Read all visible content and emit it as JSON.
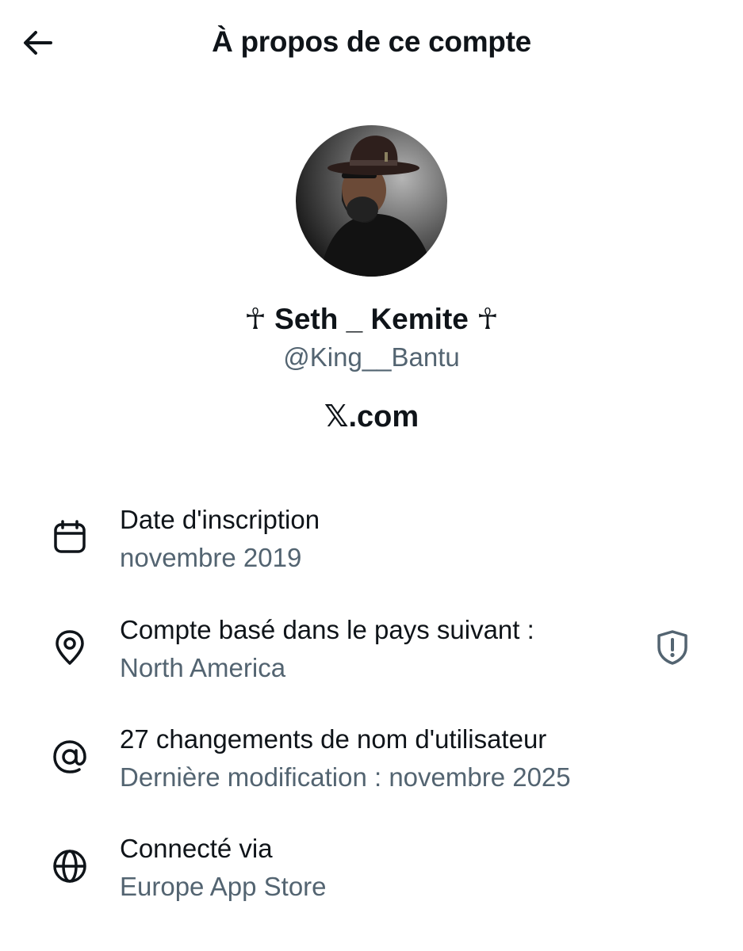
{
  "header": {
    "title": "À propos de ce compte",
    "back_icon": "arrow-left-icon"
  },
  "profile": {
    "display_name": "☥ Seth _ Kemite ☥",
    "handle": "@King__Bantu",
    "domain": "𝕏.com"
  },
  "details": [
    {
      "icon": "calendar-icon",
      "title": "Date d'inscription",
      "subtitle": "novembre 2019"
    },
    {
      "icon": "location-pin-icon",
      "title": "Compte basé dans le pays suivant :",
      "subtitle": "North America",
      "action_icon": "shield-alert-icon"
    },
    {
      "icon": "at-sign-icon",
      "title": "27 changements de nom d'utilisateur",
      "subtitle": "Dernière modification : novembre 2025"
    },
    {
      "icon": "globe-icon",
      "title": "Connecté via",
      "subtitle": "Europe App Store"
    }
  ],
  "colors": {
    "text_primary": "#0f1419",
    "text_secondary": "#536471",
    "background": "#ffffff"
  }
}
